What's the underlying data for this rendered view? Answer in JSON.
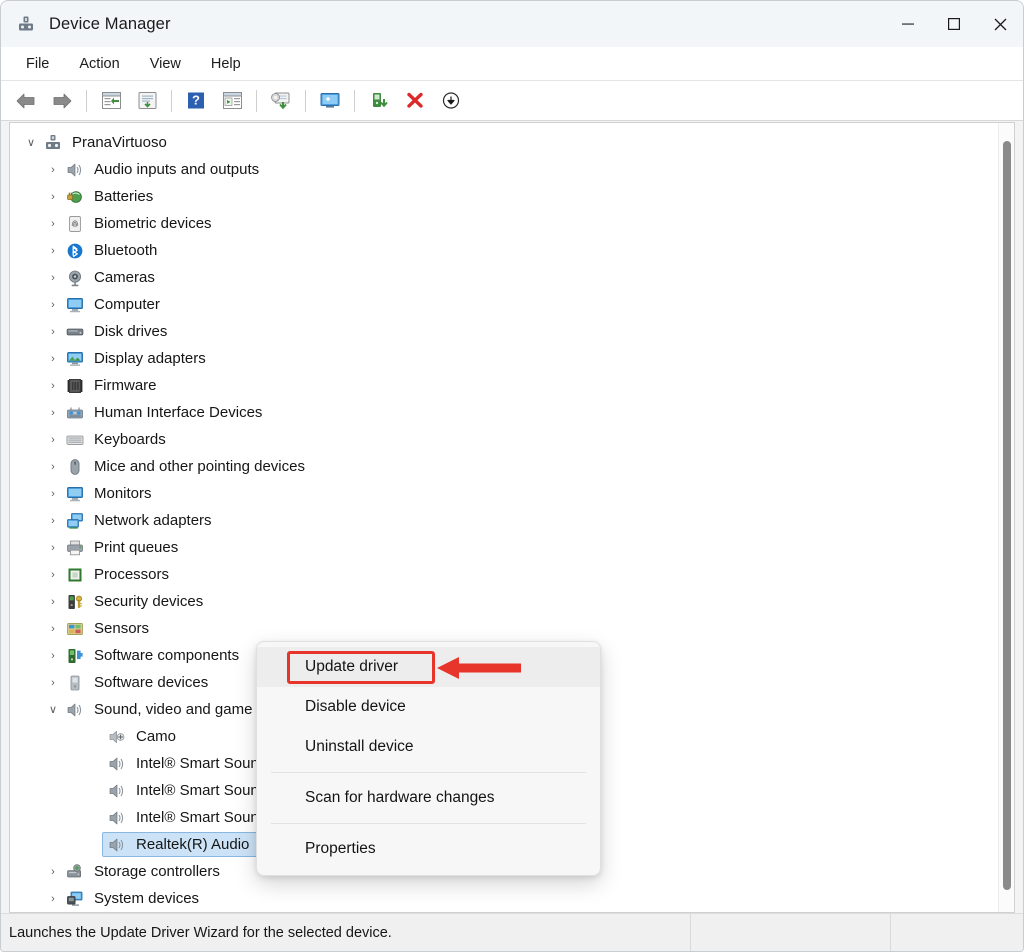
{
  "window": {
    "title": "Device Manager",
    "icon": "device-manager-icon",
    "controls": {
      "minimize": "–",
      "maximize": "☐",
      "close": "✕"
    }
  },
  "menubar": {
    "items": [
      {
        "label": "File"
      },
      {
        "label": "Action"
      },
      {
        "label": "View"
      },
      {
        "label": "Help"
      }
    ]
  },
  "toolbar": {
    "buttons": [
      {
        "name": "back-icon"
      },
      {
        "name": "forward-icon"
      },
      {
        "name": "separator"
      },
      {
        "name": "properties-icon"
      },
      {
        "name": "print-icon"
      },
      {
        "name": "separator"
      },
      {
        "name": "help-icon"
      },
      {
        "name": "show-hidden-devices-icon"
      },
      {
        "name": "separator"
      },
      {
        "name": "scan-for-hardware-changes-icon"
      },
      {
        "name": "separator"
      },
      {
        "name": "update-device-icon"
      },
      {
        "name": "separator"
      },
      {
        "name": "enable-device-icon"
      },
      {
        "name": "uninstall-device-icon"
      },
      {
        "name": "disable-device-icon"
      }
    ]
  },
  "tree": {
    "nodes": [
      {
        "label": "PranaVirtuoso",
        "depth": 0,
        "expander": "expanded",
        "icon": "computer-root-icon",
        "selected": false
      },
      {
        "label": "Audio inputs and outputs",
        "depth": 1,
        "expander": "collapsed",
        "icon": "speaker-icon",
        "selected": false
      },
      {
        "label": "Batteries",
        "depth": 1,
        "expander": "collapsed",
        "icon": "battery-icon",
        "selected": false
      },
      {
        "label": "Biometric devices",
        "depth": 1,
        "expander": "collapsed",
        "icon": "fingerprint-icon",
        "selected": false
      },
      {
        "label": "Bluetooth",
        "depth": 1,
        "expander": "collapsed",
        "icon": "bluetooth-icon",
        "selected": false
      },
      {
        "label": "Cameras",
        "depth": 1,
        "expander": "collapsed",
        "icon": "camera-icon",
        "selected": false
      },
      {
        "label": "Computer",
        "depth": 1,
        "expander": "collapsed",
        "icon": "monitor-icon",
        "selected": false
      },
      {
        "label": "Disk drives",
        "depth": 1,
        "expander": "collapsed",
        "icon": "disk-drive-icon",
        "selected": false
      },
      {
        "label": "Display adapters",
        "depth": 1,
        "expander": "collapsed",
        "icon": "display-adapter-icon",
        "selected": false
      },
      {
        "label": "Firmware",
        "depth": 1,
        "expander": "collapsed",
        "icon": "firmware-chip-icon",
        "selected": false
      },
      {
        "label": "Human Interface Devices",
        "depth": 1,
        "expander": "collapsed",
        "icon": "hid-icon",
        "selected": false
      },
      {
        "label": "Keyboards",
        "depth": 1,
        "expander": "collapsed",
        "icon": "keyboard-icon",
        "selected": false
      },
      {
        "label": "Mice and other pointing devices",
        "depth": 1,
        "expander": "collapsed",
        "icon": "mouse-icon",
        "selected": false
      },
      {
        "label": "Monitors",
        "depth": 1,
        "expander": "collapsed",
        "icon": "monitor-icon",
        "selected": false
      },
      {
        "label": "Network adapters",
        "depth": 1,
        "expander": "collapsed",
        "icon": "network-adapter-icon",
        "selected": false
      },
      {
        "label": "Print queues",
        "depth": 1,
        "expander": "collapsed",
        "icon": "printer-icon",
        "selected": false
      },
      {
        "label": "Processors",
        "depth": 1,
        "expander": "collapsed",
        "icon": "processor-icon",
        "selected": false
      },
      {
        "label": "Security devices",
        "depth": 1,
        "expander": "collapsed",
        "icon": "security-device-icon",
        "selected": false
      },
      {
        "label": "Sensors",
        "depth": 1,
        "expander": "collapsed",
        "icon": "sensor-icon",
        "selected": false
      },
      {
        "label": "Software components",
        "depth": 1,
        "expander": "collapsed",
        "icon": "software-component-icon",
        "selected": false
      },
      {
        "label": "Software devices",
        "depth": 1,
        "expander": "collapsed",
        "icon": "software-device-icon",
        "selected": false
      },
      {
        "label": "Sound, video and game controllers",
        "depth": 1,
        "expander": "expanded",
        "icon": "speaker-icon",
        "selected": false
      },
      {
        "label": "Camo",
        "depth": 2,
        "expander": "none",
        "icon": "camo-audio-icon",
        "selected": false
      },
      {
        "label": "Intel® Smart Sound Technology for Bluetooth®",
        "depth": 2,
        "expander": "none",
        "icon": "speaker-icon",
        "selected": false
      },
      {
        "label": "Intel® Smart Sound Technology for USB Audio",
        "depth": 2,
        "expander": "none",
        "icon": "speaker-icon",
        "selected": false
      },
      {
        "label": "Intel® Smart Sound Technology for Digital Microphones",
        "depth": 2,
        "expander": "none",
        "icon": "speaker-icon",
        "selected": false
      },
      {
        "label": "Realtek(R) Audio",
        "depth": 2,
        "expander": "none",
        "icon": "speaker-icon",
        "selected": true
      },
      {
        "label": "Storage controllers",
        "depth": 1,
        "expander": "collapsed",
        "icon": "storage-controller-icon",
        "selected": false
      },
      {
        "label": "System devices",
        "depth": 1,
        "expander": "collapsed",
        "icon": "system-device-icon",
        "selected": false
      }
    ],
    "expander_glyphs": {
      "collapsed": "›",
      "expanded": "∨"
    }
  },
  "context_menu": {
    "items": [
      {
        "label": "Update driver",
        "highlighted": true,
        "type": "item"
      },
      {
        "label": "Disable device",
        "highlighted": false,
        "type": "item"
      },
      {
        "label": "Uninstall device",
        "highlighted": false,
        "type": "item"
      },
      {
        "label": "",
        "type": "separator"
      },
      {
        "label": "Scan for hardware changes",
        "highlighted": false,
        "type": "item"
      },
      {
        "label": "",
        "type": "separator"
      },
      {
        "label": "Properties",
        "highlighted": false,
        "type": "item"
      }
    ]
  },
  "annotation": {
    "target": "Update driver",
    "color": "#e8352b",
    "shape": "box-with-left-arrow"
  },
  "statusbar": {
    "message": "Launches the Update Driver Wizard for the selected device."
  },
  "colors": {
    "selection_fill": "#cce3f7",
    "selection_border": "#8ab7e2",
    "annotation_red": "#e8352b",
    "titlebar_bg": "#f3f6f9",
    "statusbar_bg": "#f0f0f0"
  }
}
